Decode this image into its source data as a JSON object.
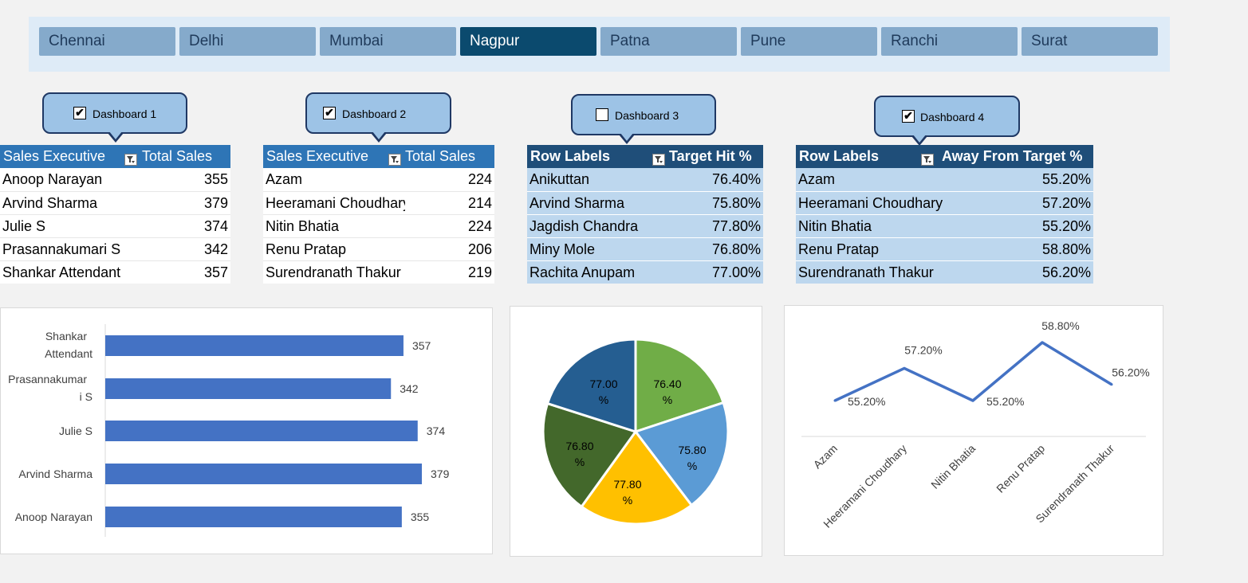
{
  "slicer": {
    "cities": [
      "Chennai",
      "Delhi",
      "Mumbai",
      "Nagpur",
      "Patna",
      "Pune",
      "Ranchi",
      "Surat"
    ],
    "selected": "Nagpur"
  },
  "dashboards": [
    {
      "label": "Dashboard 1",
      "checked": true
    },
    {
      "label": "Dashboard 2",
      "checked": true
    },
    {
      "label": "Dashboard 3",
      "checked": false
    },
    {
      "label": "Dashboard 4",
      "checked": true
    }
  ],
  "tables": [
    {
      "headers": [
        "Sales Executive",
        "Total Sales"
      ],
      "rows": [
        [
          "Anoop Narayan",
          "355"
        ],
        [
          "Arvind Sharma",
          "379"
        ],
        [
          "Julie S",
          "374"
        ],
        [
          "Prasannakumari S",
          "342"
        ],
        [
          "Shankar Attendant",
          "357"
        ]
      ]
    },
    {
      "headers": [
        "Sales Executive",
        "Total Sales"
      ],
      "rows": [
        [
          "Azam",
          "224"
        ],
        [
          "Heeramani Choudhary",
          "214"
        ],
        [
          "Nitin Bhatia",
          "224"
        ],
        [
          "Renu Pratap",
          "206"
        ],
        [
          "Surendranath Thakur",
          "219"
        ]
      ]
    },
    {
      "headers": [
        "Row Labels",
        "Target Hit %"
      ],
      "rows": [
        [
          "Anikuttan",
          "76.40%"
        ],
        [
          "Arvind Sharma",
          "75.80%"
        ],
        [
          "Jagdish Chandra",
          "77.80%"
        ],
        [
          "Miny Mole",
          "76.80%"
        ],
        [
          "Rachita Anupam",
          "77.00%"
        ]
      ]
    },
    {
      "headers": [
        "Row Labels",
        "Away From Target %"
      ],
      "rows": [
        [
          "Azam",
          "55.20%"
        ],
        [
          "Heeramani Choudhary",
          "57.20%"
        ],
        [
          "Nitin Bhatia",
          "55.20%"
        ],
        [
          "Renu Pratap",
          "58.80%"
        ],
        [
          "Surendranath Thakur",
          "56.20%"
        ]
      ]
    }
  ],
  "colors": {
    "header_blue": "#2e75b6",
    "header_dark": "#1f4e79",
    "row_light": "#bdd7ee",
    "slicer_selected": "#0b4a6e",
    "slicer_button": "#85aacb",
    "bar": "#4472c4",
    "line": "#4472c4"
  },
  "icons": {
    "filter": "filter-dropdown-icon",
    "checkbox": "checkbox-icon"
  },
  "chart_data": [
    {
      "type": "bar",
      "orientation": "horizontal",
      "categories": [
        "Shankar Attendant",
        "Prasannakumari S",
        "Julie S",
        "Arvind Sharma",
        "Anoop Narayan"
      ],
      "values": [
        357,
        342,
        374,
        379,
        355
      ],
      "data_labels": true,
      "title": "",
      "xlabel": "",
      "ylabel": "",
      "xlim": [
        0,
        420
      ]
    },
    {
      "type": "pie",
      "categories": [
        "Anikuttan",
        "Arvind Sharma",
        "Jagdish Chandra",
        "Miny Mole",
        "Rachita Anupam"
      ],
      "values": [
        76.4,
        75.8,
        77.8,
        76.8,
        77.0
      ],
      "labels": [
        "76.40 %",
        "75.80 %",
        "77.80 %",
        "76.80 %",
        "77.00 %"
      ],
      "colors": [
        "#70ad47",
        "#5b9bd5",
        "#ffc000",
        "#43682b",
        "#255e91"
      ],
      "title": ""
    },
    {
      "type": "line",
      "categories": [
        "Azam",
        "Heeramani Choudhary",
        "Nitin Bhatia",
        "Renu Pratap",
        "Surendranath Thakur"
      ],
      "values": [
        55.2,
        57.2,
        55.2,
        58.8,
        56.2
      ],
      "labels": [
        "55.20%",
        "57.20%",
        "55.20%",
        "58.80%",
        "56.20%"
      ],
      "title": "",
      "ylim": [
        50,
        60
      ]
    }
  ]
}
